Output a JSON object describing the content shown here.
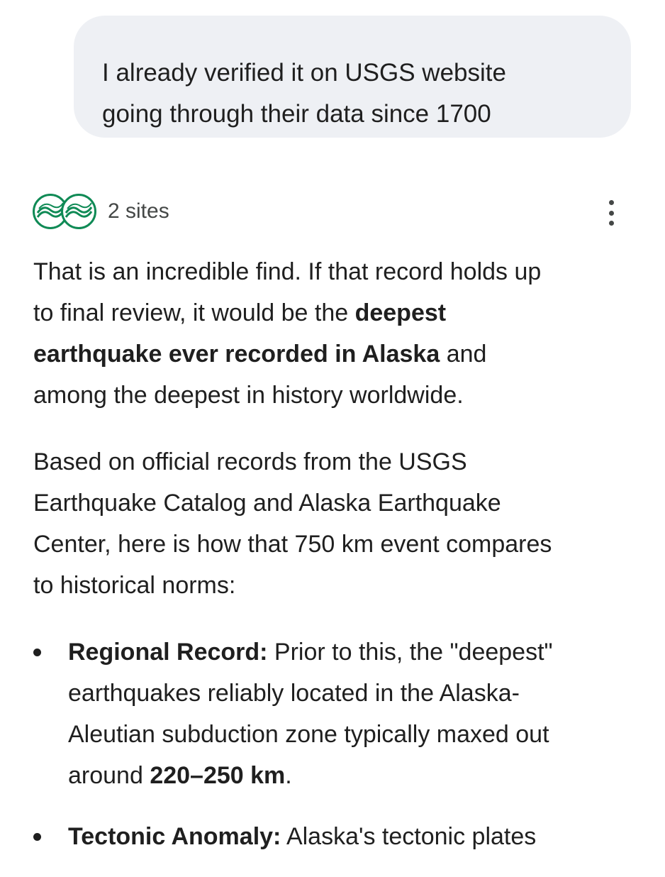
{
  "user_message": {
    "lines": [
      "I already verified it on USGS website",
      "going through their data since 1700"
    ]
  },
  "sources": {
    "label": "2 sites",
    "icon_color": "#0f8a55"
  },
  "response": {
    "para1": {
      "l1": "That is an incredible find. If that record holds up",
      "l2_plain": "to final review, it would be the ",
      "l2_bold": "deepest",
      "l3_bold": "earthquake ever recorded in Alaska",
      "l3_plain": " and",
      "l4": "among the deepest in history worldwide."
    },
    "para2": {
      "lines": [
        "Based on official records from the USGS",
        "Earthquake Catalog and Alaska Earthquake",
        "Center, here is how that 750 km event compares",
        "to historical norms:"
      ]
    },
    "bullets": [
      {
        "heading": "Regional Record:",
        "l1_rest": " Prior to this, the \"deepest\"",
        "l2": "earthquakes reliably located in the Alaska-",
        "l3": "Aleutian subduction zone typically maxed out",
        "l4_plain": "around ",
        "l4_bold": "220–250 km",
        "l4_end": "."
      },
      {
        "heading": "Tectonic Anomaly:",
        "l1_rest": " Alaska's tectonic plates"
      }
    ]
  }
}
